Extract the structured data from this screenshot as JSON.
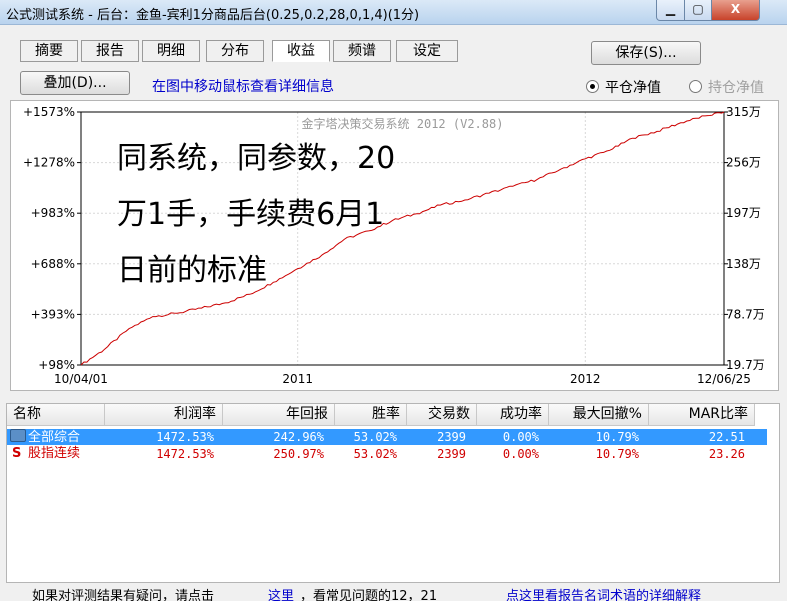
{
  "window": {
    "title": "公式测试系统 - 后台：金鱼-宾利1分商品后台(0.25,0.2,28,0,1,4)(1分)",
    "close_glyph": "X"
  },
  "tabs": [
    {
      "label": "摘要"
    },
    {
      "label": "报告"
    },
    {
      "label": "明细"
    },
    {
      "label": "分布"
    },
    {
      "label": "收益",
      "active": true
    },
    {
      "label": "频谱"
    },
    {
      "label": "设定"
    }
  ],
  "toolbar": {
    "save_label": "保存(S)...",
    "overlay_label": "叠加(D)...",
    "hint": "在图中移动鼠标查看详细信息",
    "radio_close": "平仓净值",
    "radio_hold": "持仓净值"
  },
  "chart_data": {
    "type": "line",
    "watermark": "金字塔决策交易系统 2012 (V2.88)",
    "overlay_lines": [
      "同系统，同参数，20",
      "万1手，手续费6月1",
      "日前的标准"
    ],
    "left_ticks": [
      "+1573%",
      "+1278%",
      "+983%",
      "+688%",
      "+393%",
      "+98%"
    ],
    "right_ticks": [
      "315万",
      "256万",
      "197万",
      "138万",
      "78.7万",
      "19.7万"
    ],
    "x_ticks": [
      "10/04/01",
      "2011",
      "2012",
      "12/06/25"
    ],
    "ylim": [
      98,
      1573
    ],
    "x_range": [
      "2010-04-01",
      "2012-06-25"
    ],
    "grid": true,
    "colors": {
      "line": "#cc0000",
      "grid": "#d8d8d8",
      "frame": "#000000"
    },
    "series": [
      {
        "x": [
          "2010-04-01",
          "2010-05-01",
          "2010-06-01",
          "2010-07-01",
          "2010-08-01",
          "2010-09-01",
          "2010-10-01",
          "2010-11-01",
          "2010-12-01",
          "2011-01-01",
          "2011-02-01",
          "2011-03-01",
          "2011-04-01",
          "2011-05-01",
          "2011-06-01",
          "2011-07-01",
          "2011-08-01",
          "2011-09-01",
          "2011-10-01",
          "2011-11-01",
          "2011-12-01",
          "2012-01-01",
          "2012-02-01",
          "2012-03-01",
          "2012-04-01",
          "2012-05-01",
          "2012-06-01",
          "2012-06-25"
        ],
        "y": [
          98,
          190,
          310,
          380,
          400,
          430,
          460,
          510,
          580,
          660,
          740,
          830,
          880,
          940,
          980,
          1030,
          1060,
          1100,
          1140,
          1180,
          1240,
          1300,
          1350,
          1420,
          1460,
          1510,
          1550,
          1573
        ]
      }
    ]
  },
  "table": {
    "headers": [
      "名称",
      "利润率",
      "年回报",
      "胜率",
      "交易数",
      "成功率",
      "最大回撤%",
      "MAR比率"
    ],
    "rows": [
      {
        "prefix": "",
        "name": "全部综合",
        "cells": [
          "1472.53%",
          "242.96%",
          "53.02%",
          "2399",
          "0.00%",
          "10.79%",
          "22.51"
        ]
      },
      {
        "prefix": "S",
        "name": "股指连续",
        "cells": [
          "1472.53%",
          "250.97%",
          "53.02%",
          "2399",
          "0.00%",
          "10.79%",
          "23.26"
        ]
      }
    ]
  },
  "footer": {
    "text1": "如果对评测结果有疑问，请点击",
    "link1": "这里",
    "text2": "，看常见问题的12，21",
    "link2": "点这里看报告名词术语的详细解释"
  }
}
